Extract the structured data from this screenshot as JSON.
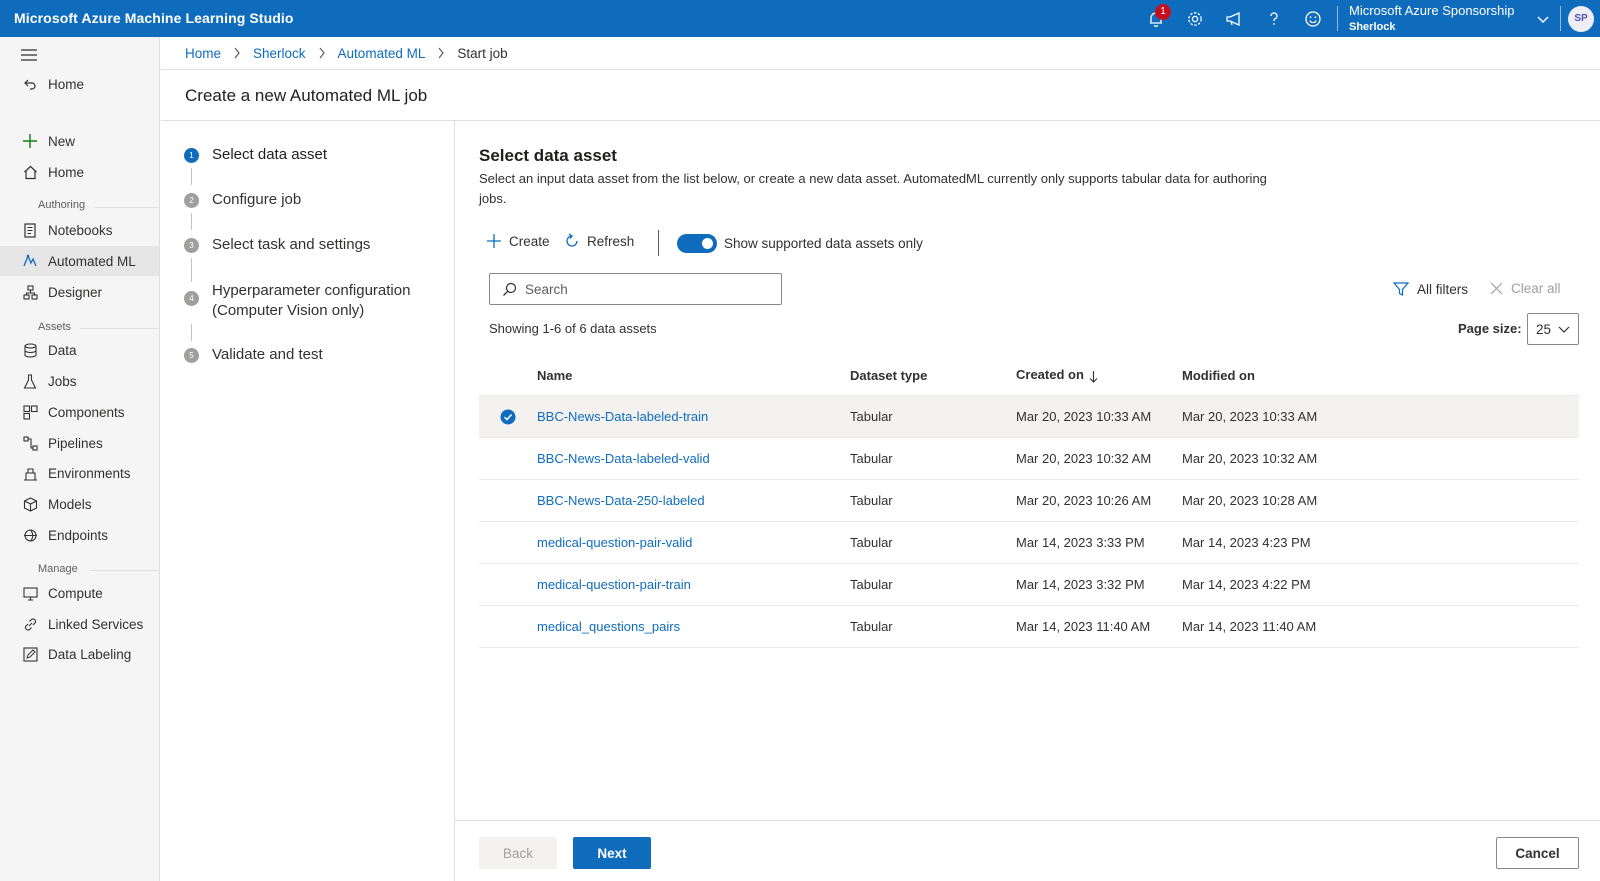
{
  "topbar": {
    "app_title": "Microsoft Azure Machine Learning Studio",
    "notification_count": "1",
    "account_subscription": "Microsoft Azure Sponsorship",
    "account_workspace": "Sherlock",
    "avatar_initials": "SP",
    "brand_color": "#0f6cbd"
  },
  "sidebar": {
    "top_items": [
      {
        "label": "Home",
        "icon": "back-arrow-icon"
      }
    ],
    "items_1": [
      {
        "label": "New",
        "icon": "plus-icon"
      },
      {
        "label": "Home",
        "icon": "home-icon"
      }
    ],
    "section_authoring": "Authoring",
    "authoring_items": [
      {
        "label": "Notebooks",
        "icon": "notebook-icon"
      },
      {
        "label": "Automated ML",
        "icon": "automl-icon",
        "active": true
      },
      {
        "label": "Designer",
        "icon": "designer-icon"
      }
    ],
    "section_assets": "Assets",
    "assets_items": [
      {
        "label": "Data",
        "icon": "data-icon"
      },
      {
        "label": "Jobs",
        "icon": "flask-icon"
      },
      {
        "label": "Components",
        "icon": "components-icon"
      },
      {
        "label": "Pipelines",
        "icon": "pipeline-icon"
      },
      {
        "label": "Environments",
        "icon": "environment-icon"
      },
      {
        "label": "Models",
        "icon": "cube-icon"
      },
      {
        "label": "Endpoints",
        "icon": "endpoint-icon"
      }
    ],
    "section_manage": "Manage",
    "manage_items": [
      {
        "label": "Compute",
        "icon": "monitor-icon"
      },
      {
        "label": "Linked Services",
        "icon": "link-icon"
      },
      {
        "label": "Data Labeling",
        "icon": "edit-icon"
      }
    ]
  },
  "breadcrumb": [
    "Home",
    "Sherlock",
    "Automated ML",
    "Start job"
  ],
  "page_title": "Create a new Automated ML job",
  "wizard": {
    "steps": [
      {
        "num": "1",
        "label": "Select data asset",
        "active": true
      },
      {
        "num": "2",
        "label": "Configure job"
      },
      {
        "num": "3",
        "label": "Select task and settings"
      },
      {
        "num": "4",
        "label": "Hyperparameter configuration",
        "label2": "(Computer Vision only)"
      },
      {
        "num": "5",
        "label": "Validate and test"
      }
    ]
  },
  "main": {
    "title": "Select data asset",
    "description": "Select an input data asset from the list below, or create a new data asset. AutomatedML currently only supports tabular data for authoring jobs.",
    "toolbar": {
      "create_label": "Create",
      "refresh_label": "Refresh",
      "toggle_label": "Show supported data assets only",
      "toggle_on": true
    },
    "search": {
      "placeholder": "Search",
      "value": ""
    },
    "filters": {
      "all_filters_label": "All filters",
      "clear_all_label": "Clear all"
    },
    "showing": "Showing 1-6 of 6 data assets",
    "page_size_label": "Page size:",
    "page_size_value": "25",
    "table": {
      "headers": {
        "name": "Name",
        "type": "Dataset type",
        "created": "Created on",
        "modified": "Modified on"
      },
      "sort_column": "created",
      "sort_direction": "descending",
      "rows": [
        {
          "name": "BBC-News-Data-labeled-train",
          "type": "Tabular",
          "created": "Mar 20, 2023 10:33 AM",
          "modified": "Mar 20, 2023 10:33 AM",
          "selected": true
        },
        {
          "name": "BBC-News-Data-labeled-valid",
          "type": "Tabular",
          "created": "Mar 20, 2023 10:32 AM",
          "modified": "Mar 20, 2023 10:32 AM"
        },
        {
          "name": "BBC-News-Data-250-labeled",
          "type": "Tabular",
          "created": "Mar 20, 2023 10:26 AM",
          "modified": "Mar 20, 2023 10:28 AM"
        },
        {
          "name": "medical-question-pair-valid",
          "type": "Tabular",
          "created": "Mar 14, 2023 3:33 PM",
          "modified": "Mar 14, 2023 4:23 PM"
        },
        {
          "name": "medical-question-pair-train",
          "type": "Tabular",
          "created": "Mar 14, 2023 3:32 PM",
          "modified": "Mar 14, 2023 4:22 PM"
        },
        {
          "name": "medical_questions_pairs",
          "type": "Tabular",
          "created": "Mar 14, 2023 11:40 AM",
          "modified": "Mar 14, 2023 11:40 AM"
        }
      ]
    }
  },
  "footer": {
    "back_label": "Back",
    "next_label": "Next",
    "cancel_label": "Cancel"
  }
}
